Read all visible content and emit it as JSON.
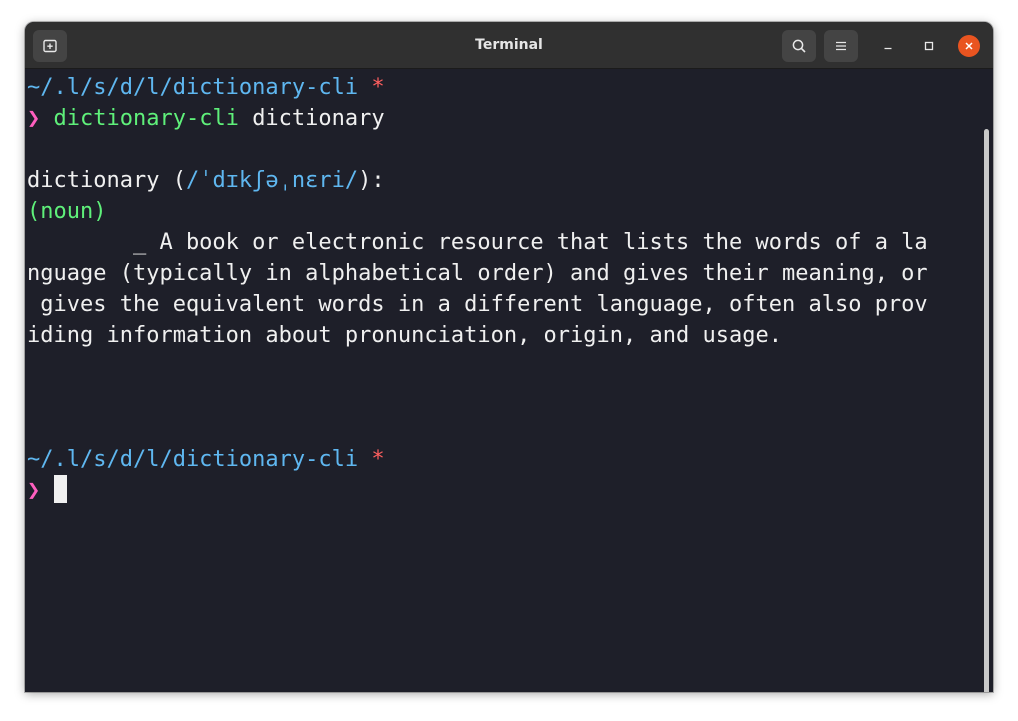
{
  "window": {
    "title": "Terminal"
  },
  "icons": {
    "new_tab": "new-tab-icon",
    "search": "search-icon",
    "menu": "hamburger-menu-icon",
    "minimize": "minimize-icon",
    "maximize": "maximize-icon",
    "close": "close-icon"
  },
  "colors": {
    "terminal_bg": "#1e1f29",
    "path": "#5fb7f0",
    "dirty_star": "#ff5f5f",
    "prompt_arrow": "#ff5fbf",
    "command": "#5ff07a",
    "close_button": "#e95420"
  },
  "terminal": {
    "prompt1": {
      "path": "~/.l/s/d/l/dictionary-cli",
      "dirty_marker": "*",
      "arrow": "❯",
      "command": "dictionary-cli",
      "argument": "dictionary"
    },
    "output": {
      "word": "dictionary",
      "open_paren": "(",
      "pronunciation": "/ˈdɪkʃəˌnɛri/",
      "close_paren_colon": "):",
      "part_of_speech": "(noun)",
      "definition_lines": [
        "        _ A book or electronic resource that lists the words of a la",
        "nguage (typically in alphabetical order) and gives their meaning, or",
        " gives the equivalent words in a different language, often also prov",
        "iding information about pronunciation, origin, and usage."
      ]
    },
    "prompt2": {
      "path": "~/.l/s/d/l/dictionary-cli",
      "dirty_marker": "*",
      "arrow": "❯"
    }
  }
}
